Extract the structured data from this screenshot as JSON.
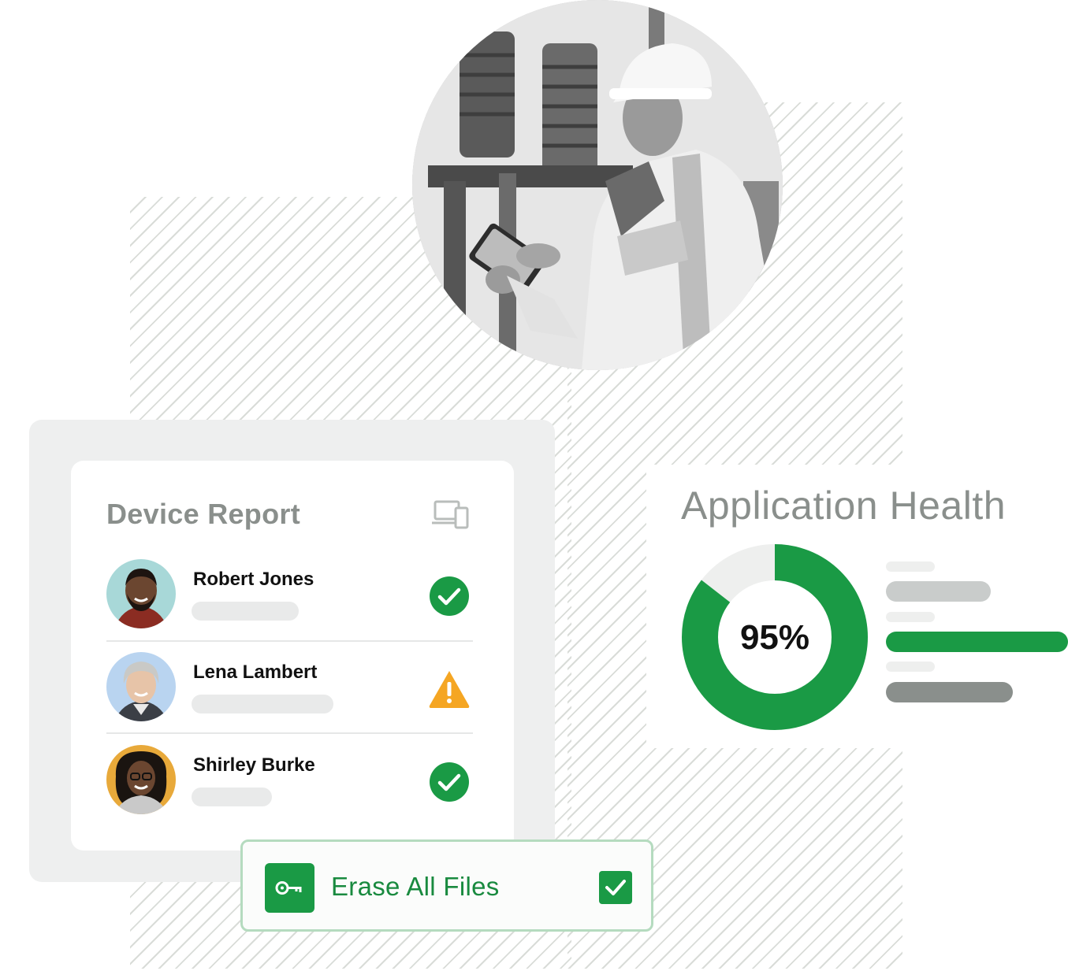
{
  "device_report": {
    "title": "Device Report",
    "device_icon": "devices-icon",
    "users": [
      {
        "name": "Robert Jones",
        "status": "ok",
        "status_icon": "check-circle-icon",
        "avatar_bg": "#a8d8d8"
      },
      {
        "name": "Lena Lambert",
        "status": "warning",
        "status_icon": "warning-triangle-icon",
        "avatar_bg": "#b9d4f0"
      },
      {
        "name": "Shirley Burke",
        "status": "ok",
        "status_icon": "check-circle-icon",
        "avatar_bg": "#e8a93a"
      }
    ]
  },
  "erase_action": {
    "label": "Erase All Files",
    "icon": "key-icon",
    "checked": true
  },
  "application_health": {
    "title": "Application Health",
    "percent_label": "95%",
    "percent": 95
  },
  "colors": {
    "brand_green": "#1a9a45",
    "ok_green": "#1a9a45",
    "warning_amber": "#f5a623",
    "muted_text": "#8a8f8c"
  }
}
